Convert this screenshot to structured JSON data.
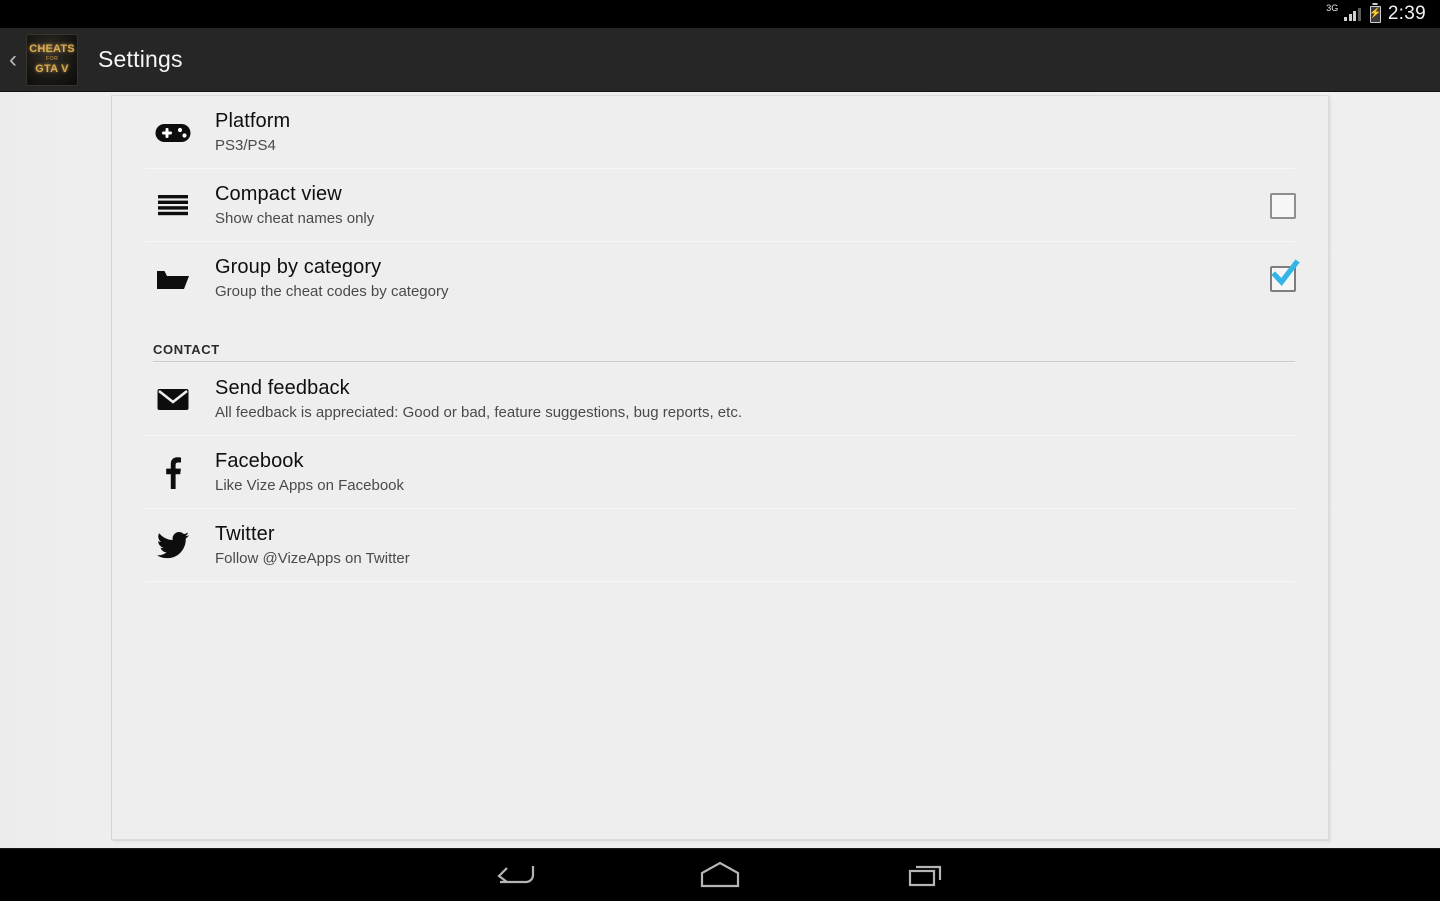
{
  "status_bar": {
    "network_label": "3G",
    "signal_icon": "signal-bars-icon",
    "battery_icon": "battery-charging-icon",
    "time": "2:39"
  },
  "action_bar": {
    "back_icon": "back-chevron-icon",
    "app_icon": {
      "line1": "CHEATS",
      "line2": "FOR",
      "line3": "GTA V"
    },
    "title": "Settings"
  },
  "settings": {
    "rows": [
      {
        "icon": "gamepad-icon",
        "title": "Platform",
        "subtitle": "PS3/PS4",
        "control": "none",
        "checked": false
      },
      {
        "icon": "list-lines-icon",
        "title": "Compact view",
        "subtitle": "Show cheat names only",
        "control": "checkbox",
        "checked": false
      },
      {
        "icon": "folder-open-icon",
        "title": "Group by category",
        "subtitle": "Group the cheat codes by category",
        "control": "checkbox",
        "checked": true
      }
    ],
    "section_header": "CONTACT",
    "contact_rows": [
      {
        "icon": "envelope-icon",
        "title": "Send feedback",
        "subtitle": "All feedback is appreciated: Good or bad, feature suggestions, bug reports, etc."
      },
      {
        "icon": "facebook-icon",
        "title": "Facebook",
        "subtitle": "Like Vize Apps on Facebook"
      },
      {
        "icon": "twitter-icon",
        "title": "Twitter",
        "subtitle": "Follow @VizeApps on Twitter"
      }
    ]
  },
  "nav_bar": {
    "back": "back-icon",
    "home": "home-icon",
    "recents": "recents-icon"
  },
  "colors": {
    "accent_check": "#33b5e5",
    "action_bar": "#262626",
    "card": "#eeeeee",
    "page": "#eeeeee"
  }
}
